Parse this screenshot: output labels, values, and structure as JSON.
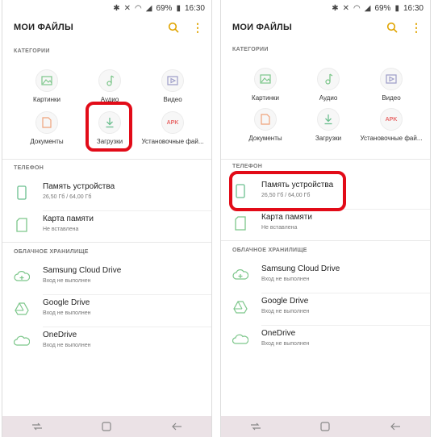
{
  "status_bar": {
    "battery": "69%",
    "time": "16:30",
    "icons": [
      "bluetooth-icon",
      "mute-icon",
      "wifi-icon",
      "signal-icon",
      "battery-icon"
    ]
  },
  "app": {
    "title": "МОИ ФАЙЛЫ"
  },
  "sections": {
    "categories": "КАТЕГОРИИ",
    "phone": "ТЕЛЕФОН",
    "cloud": "ОБЛАЧНОЕ ХРАНИЛИЩЕ"
  },
  "categories": [
    {
      "label": "Картинки",
      "icon": "image-icon",
      "color": "#7cc68a"
    },
    {
      "label": "Аудио",
      "icon": "music-icon",
      "color": "#7cc68a"
    },
    {
      "label": "Видео",
      "icon": "video-icon",
      "color": "#9c9cc8"
    },
    {
      "label": "Документы",
      "icon": "document-icon",
      "color": "#f0a27a"
    },
    {
      "label": "Загрузки",
      "icon": "download-icon",
      "color": "#6bbf8f"
    },
    {
      "label": "Установочные фай...",
      "icon": "apk-icon",
      "color": "#e86b6b",
      "badge": "APK"
    }
  ],
  "phone_storage": [
    {
      "title": "Память устройства",
      "subtitle": "26,50 Гб / 64,00 Гб",
      "icon": "device-storage-icon"
    },
    {
      "title": "Карта памяти",
      "subtitle": "Не вставлена",
      "icon": "sd-card-icon"
    }
  ],
  "cloud_storage": [
    {
      "title": "Samsung Cloud Drive",
      "subtitle": "Вход не выполнен",
      "icon": "samsung-cloud-icon"
    },
    {
      "title": "Google Drive",
      "subtitle": "Вход не выполнен",
      "icon": "google-drive-icon"
    },
    {
      "title": "OneDrive",
      "subtitle": "Вход не выполнен",
      "icon": "onedrive-icon"
    }
  ],
  "colors": {
    "accent": "#e0a400",
    "highlight": "#e20b18",
    "green_icon": "#6bbf8f",
    "navbar": "#ebe2e6"
  }
}
